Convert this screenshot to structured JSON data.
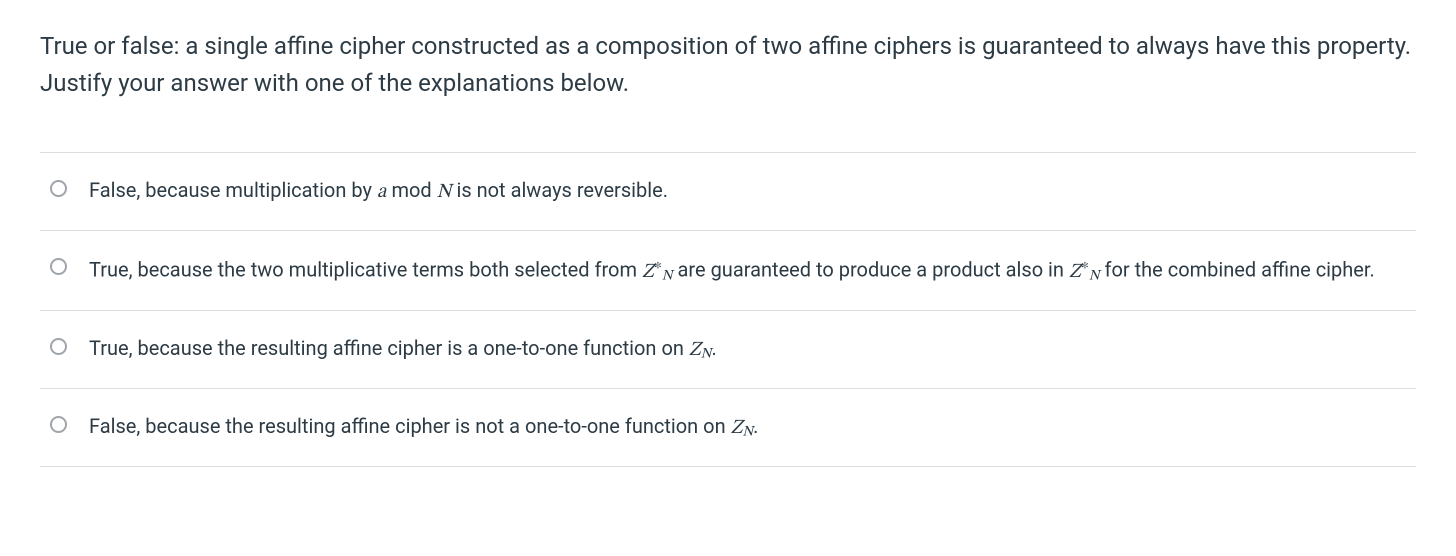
{
  "question": {
    "prompt_before": "True or false: a single affine cipher constructed as a composition of two affine ciphers is guaranteed to always have this property. Justify your answer with one of the explanations below."
  },
  "options": [
    {
      "pre": "False, because multiplication by ",
      "mid1": " mod ",
      "post": " is not always reversible."
    },
    {
      "pre": "True, because the two multiplicative terms both selected from ",
      "mid1": " are guaranteed to produce a product also in ",
      "post": " for the combined affine cipher."
    },
    {
      "pre": "True, because the resulting affine cipher is a one-to-one function on ",
      "post": "."
    },
    {
      "pre": "False, because the resulting affine cipher is not a one-to-one function on ",
      "post": "."
    }
  ],
  "math": {
    "a": "a",
    "N": "N",
    "Z": "Z",
    "star": "∗"
  }
}
